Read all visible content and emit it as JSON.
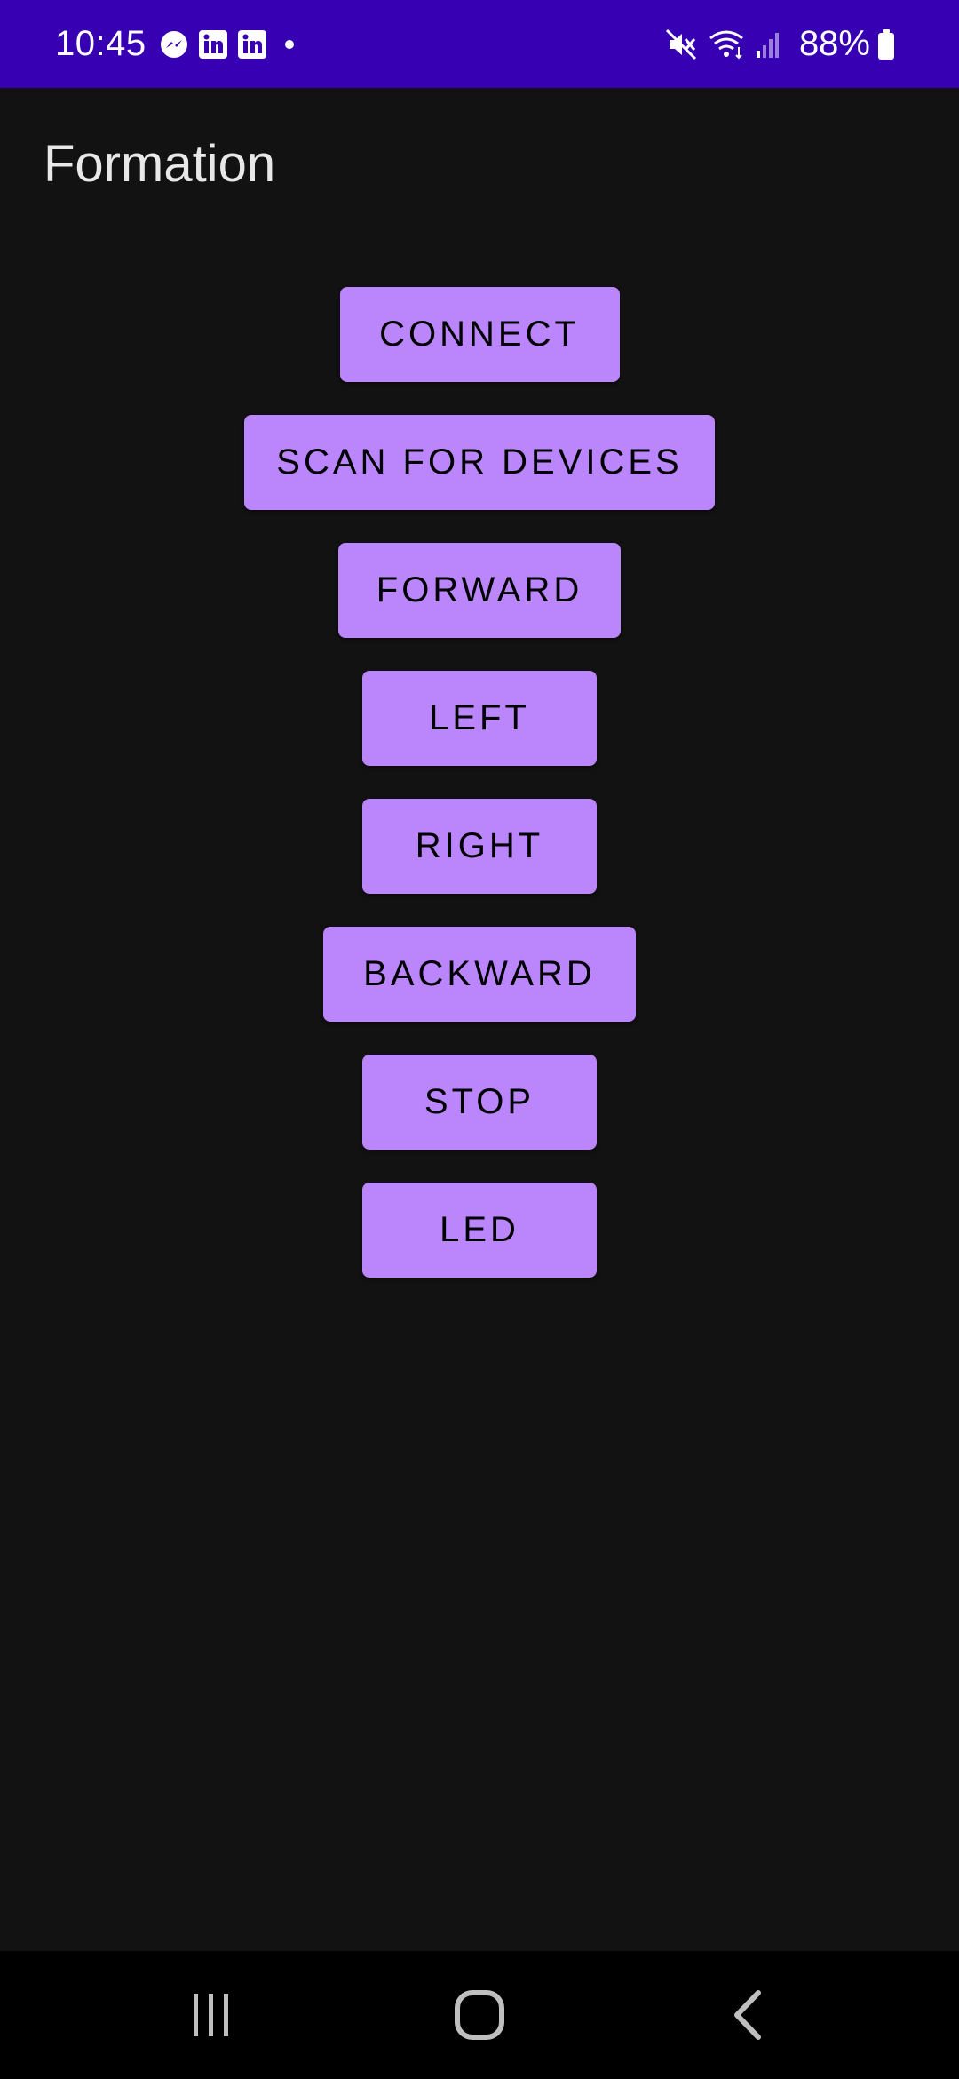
{
  "status_bar": {
    "time": "10:45",
    "battery_percent": "88%",
    "background_color": "#3700B3",
    "left_icons": [
      "messenger-icon",
      "linkedin-icon",
      "linkedin-icon",
      "notification-dot-icon"
    ],
    "right_icons": [
      "mute-icon",
      "wifi-icon",
      "signal-icon",
      "battery-icon"
    ]
  },
  "app_bar": {
    "title": "Formation"
  },
  "buttons": {
    "connect": "CONNECT",
    "scan": "SCAN FOR DEVICES",
    "forward": "FORWARD",
    "left": "LEFT",
    "right": "RIGHT",
    "backward": "BACKWARD",
    "stop": "STOP",
    "led": "LED"
  },
  "colors": {
    "button_bg": "#BB86FC",
    "screen_bg": "#121212",
    "nav_bg": "#000000"
  },
  "nav_bar": {
    "icons": [
      "recent-apps-icon",
      "home-icon",
      "back-icon"
    ]
  }
}
